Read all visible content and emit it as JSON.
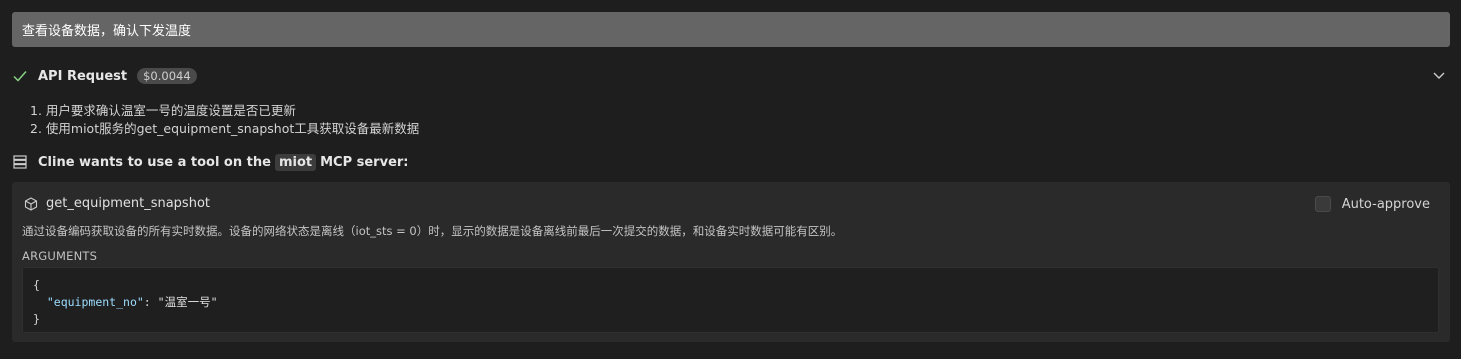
{
  "user_message": "查看设备数据，确认下发温度",
  "api_request": {
    "title": "API Request",
    "cost": "$0.0044",
    "status_icon": "check-icon",
    "expand_icon": "chevron-down-icon"
  },
  "steps": [
    "1. 用户要求确认温室一号的温度设置是否已更新",
    "2. 使用miot服务的get_equipment_snapshot工具获取设备最新数据"
  ],
  "tool_request": {
    "prefix": "Cline wants to use a tool on the",
    "server": "miot",
    "suffix": "MCP server:"
  },
  "tool": {
    "name": "get_equipment_snapshot",
    "description": "通过设备编码获取设备的所有实时数据。设备的网络状态是离线（iot_sts = 0）时，显示的数据是设备离线前最后一次提交的数据，和设备实时数据可能有区别。",
    "auto_approve_label": "Auto-approve",
    "auto_approve_checked": false,
    "arguments_label": "ARGUMENTS",
    "arguments": {
      "open": "{",
      "key": "\"equipment_no\"",
      "sep": ": ",
      "value": "\"温室一号\"",
      "close": "}"
    }
  },
  "colors": {
    "accent_check": "#89d185",
    "json_key": "#9cdcfe"
  }
}
